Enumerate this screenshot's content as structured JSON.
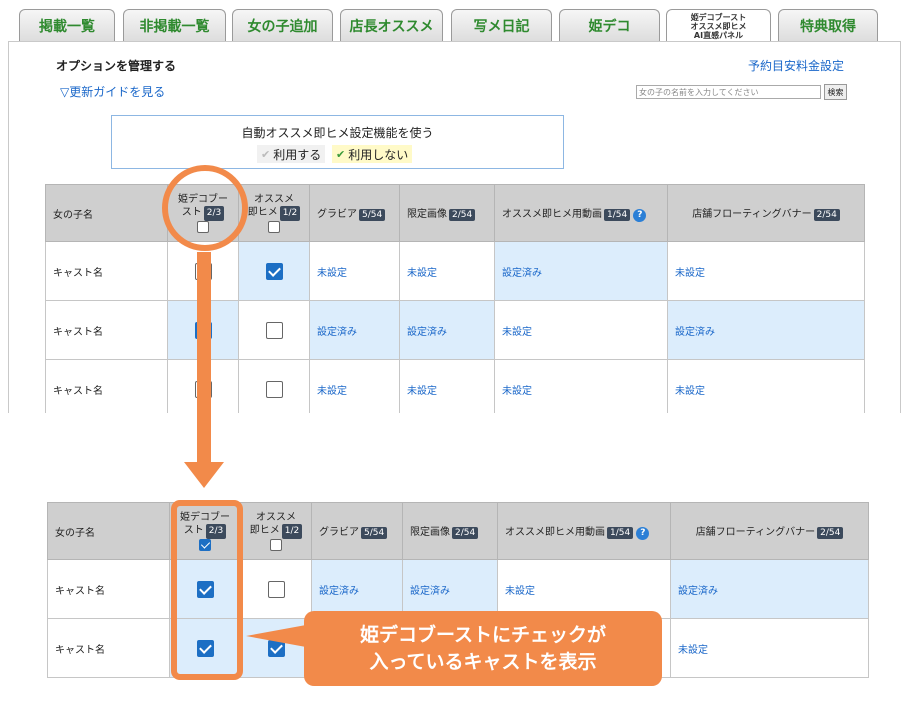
{
  "tabs": [
    {
      "label": "掲載一覧"
    },
    {
      "label": "非掲載一覧"
    },
    {
      "label": "女の子追加"
    },
    {
      "label": "店長オススメ"
    },
    {
      "label": "写メ日記"
    },
    {
      "label": "姫デコ"
    },
    {
      "label": "姫デコブースト\nオススメ即ヒメ\nAI直感パネル"
    },
    {
      "label": "特典取得"
    }
  ],
  "page": {
    "title": "オプションを管理する",
    "rate_link": "予約目安料金設定",
    "guide_link": "▽更新ガイドを見る",
    "search_placeholder": "女の子の名前を入力してください",
    "search_button": "検索"
  },
  "auto_setting": {
    "title": "自動オススメ即ヒメ設定機能を使う",
    "option_use": "利用する",
    "option_nouse": "利用しない",
    "check_glyph": "✔"
  },
  "table_headers": {
    "name": "女の子名",
    "boost_line1": "姫デコブー",
    "boost_line2": "スト",
    "boost_badge": "2/3",
    "osusume_line1": "オススメ",
    "osusume_line2": "即ヒメ",
    "osusume_badge": "1/2",
    "gravure": "グラビア",
    "gravure_badge": "5/54",
    "limited": "限定画像",
    "limited_badge": "2/54",
    "video": "オススメ即ヒメ用動画",
    "video_badge": "1/54",
    "banner": "店舗フローティングバナー",
    "banner_badge": "2/54",
    "help_icon": "?"
  },
  "lower_headers": {
    "boost_line1": "姫デコブー",
    "boost_line2": "スト",
    "osusume_line1": "オススメ",
    "osusume_line2": "即ヒメ"
  },
  "upper_rows": [
    {
      "name": "キャスト名",
      "boost": false,
      "osusume": true,
      "gravure": "未設定",
      "limited": "未設定",
      "video": "設定済み",
      "banner": "未設定"
    },
    {
      "name": "キャスト名",
      "boost": true,
      "osusume": false,
      "gravure": "設定済み",
      "limited": "設定済み",
      "video": "未設定",
      "banner": "設定済み"
    },
    {
      "name": "キャスト名",
      "boost": false,
      "osusume": false,
      "gravure": "未設定",
      "limited": "未設定",
      "video": "未設定",
      "banner": "未設定"
    }
  ],
  "lower_rows": [
    {
      "name": "キャスト名",
      "boost": true,
      "osusume": false,
      "gravure": "設定済み",
      "limited": "設定済み",
      "video": "未設定",
      "banner": "設定済み"
    },
    {
      "name": "キャスト名",
      "boost": true,
      "osusume": true,
      "gravure": "",
      "limited": "",
      "video": "",
      "banner": "未設定"
    }
  ],
  "callout": {
    "line1": "姫デコブーストにチェックが",
    "line2": "入っているキャストを表示"
  },
  "colors": {
    "accent_orange": "#f28a4a",
    "tab_text_green": "#2f8a2f",
    "link_blue": "#1a67c9",
    "checkbox_blue": "#1d6fc4",
    "highlight_row": "#dcedfc"
  }
}
